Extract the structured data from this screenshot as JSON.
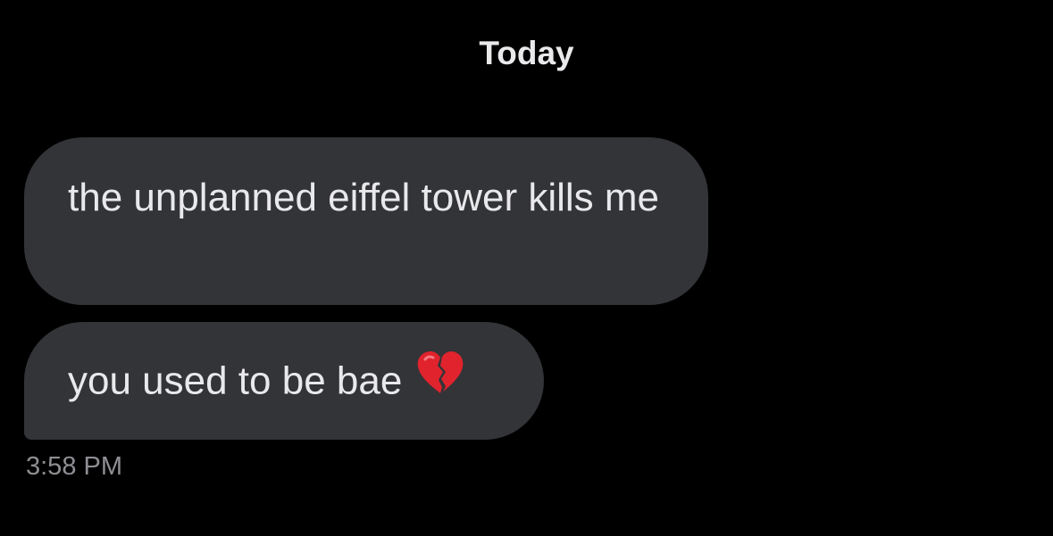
{
  "header": {
    "date_label": "Today"
  },
  "messages": [
    {
      "text": "the unplanned eiffel tower kills me"
    },
    {
      "text": "you used to be bae",
      "emoji": "broken-heart-icon"
    }
  ],
  "timestamp": "3:58 PM",
  "colors": {
    "background": "#000000",
    "bubble": "#333437",
    "text": "#e9e9eb",
    "timestamp": "#8e8e93",
    "heart": "#e0232d"
  }
}
